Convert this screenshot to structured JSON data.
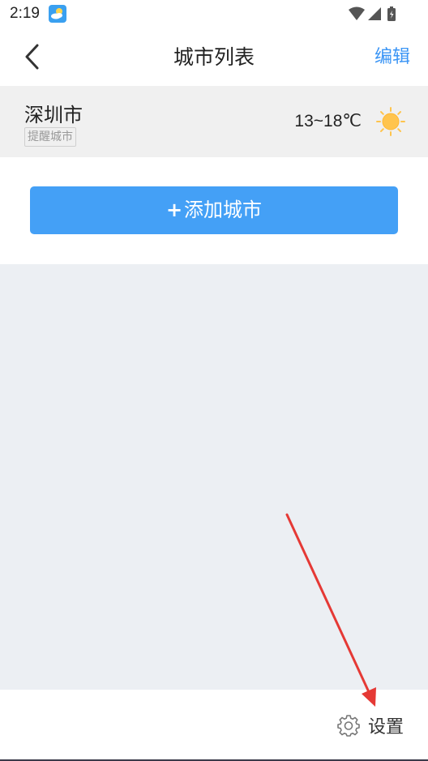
{
  "status_bar": {
    "time": "2:19"
  },
  "nav": {
    "title": "城市列表",
    "edit_label": "编辑"
  },
  "cities": [
    {
      "name": "深圳市",
      "badge": "提醒城市",
      "temperature": "13~18℃",
      "weather_icon": "sun-icon"
    }
  ],
  "add_city": {
    "plus": "+",
    "label": "添加城市"
  },
  "footer": {
    "settings_label": "设置",
    "settings_icon": "gear-icon"
  },
  "colors": {
    "accent": "#3b95f5",
    "button_bg": "#44a0f6",
    "row_bg": "#f0f0f0",
    "empty_bg": "#eceff3",
    "annotation_arrow": "#e53935",
    "sun": "#ffc44d"
  }
}
